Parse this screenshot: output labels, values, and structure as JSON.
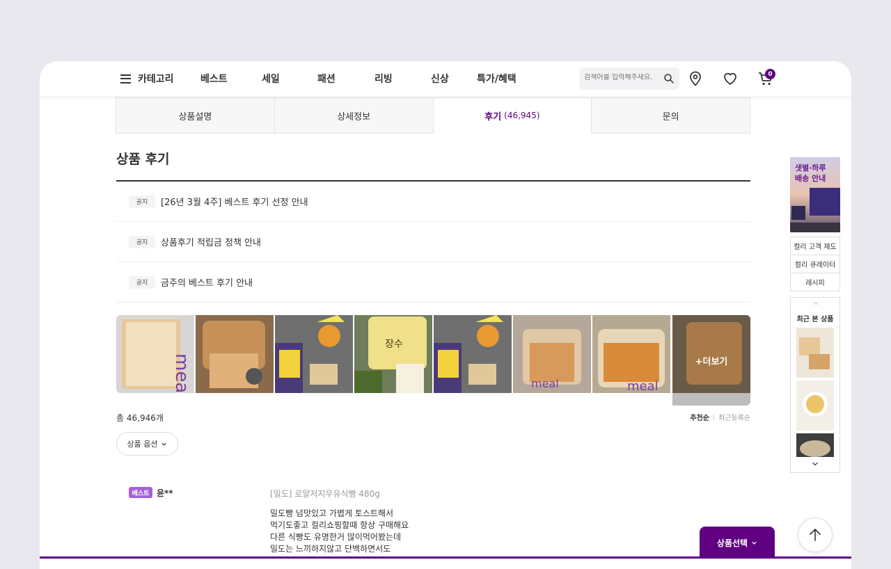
{
  "header": {
    "category_label": "카테고리",
    "nav": [
      "베스트",
      "세일",
      "패션",
      "리빙",
      "신상",
      "특가/혜택"
    ],
    "search_placeholder": "검색어를 입력해주세요.",
    "cart_count": "0"
  },
  "tabs": [
    {
      "label": "상품설명",
      "count": ""
    },
    {
      "label": "상세정보",
      "count": ""
    },
    {
      "label": "후기",
      "count": "(46,945)"
    },
    {
      "label": "문의",
      "count": ""
    }
  ],
  "active_tab": 2,
  "section_title": "상품 후기",
  "notices": [
    {
      "badge": "공지",
      "text": "[26년 3월 4주] 베스트 후기 선정 안내"
    },
    {
      "badge": "공지",
      "text": "상품후기 적립금 정책 안내"
    },
    {
      "badge": "공지",
      "text": "금주의 베스트 후기 안내"
    }
  ],
  "photos": {
    "thumb_icons": [
      "bread-photo-icon",
      "bread-photo-icon",
      "grocery-photo-icon",
      "bread-bag-photo-icon",
      "grocery-photo-icon",
      "bread-photo-icon",
      "bread-photo-icon"
    ],
    "more_label": "+더보기"
  },
  "review_summary": {
    "total_label": "총 46,946개",
    "sort_recommended": "추천순",
    "sort_recent": "최근등록순",
    "option_button": "상품 옵션"
  },
  "review": {
    "badge": "베스트",
    "user": "윤**",
    "product": "[밀도] 로얄저지우유식빵 480g",
    "lines": [
      "밀도빵 넘맛있고 가볍게 토스트해서",
      "먹기도좋고 컬리쇼핑할때 항상 구매해요",
      "다른 식빵도 유명한거 많이먹어봤는데",
      "밀도는 느끼하지않고 단백하면서도"
    ]
  },
  "rail": {
    "banner_text": "샛별·하루\n배송 안내",
    "links": [
      "컬리 고객 제도",
      "컬리 큐레이터",
      "레시피"
    ],
    "recent_title": "최근 본 상품"
  },
  "bottom": {
    "select_button": "상품선택"
  },
  "colors": {
    "brand_purple": "#5f0080",
    "best_badge": "#a462d9",
    "page_bg": "#e9e8ee"
  }
}
